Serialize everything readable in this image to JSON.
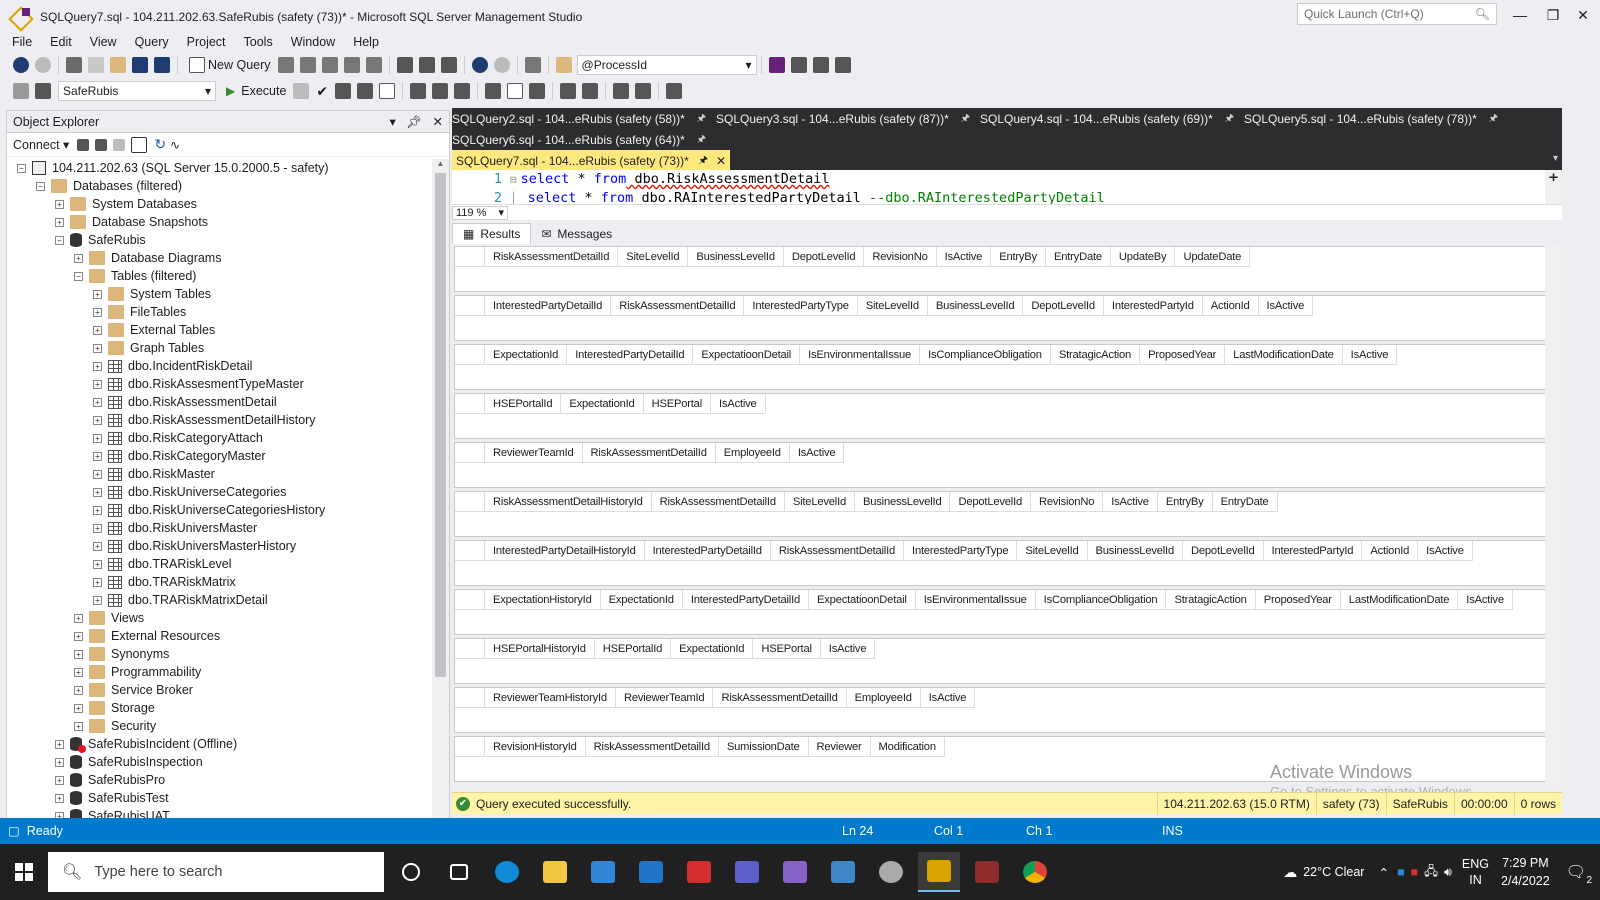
{
  "window": {
    "title": "SQLQuery7.sql - 104.211.202.63.SafeRubis (safety (73))* - Microsoft SQL Server Management Studio",
    "quick_launch_placeholder": "Quick Launch (Ctrl+Q)"
  },
  "menu": [
    "File",
    "Edit",
    "View",
    "Query",
    "Project",
    "Tools",
    "Window",
    "Help"
  ],
  "toolbar1": {
    "new_query": "New Query",
    "process_combo": "@ProcessId"
  },
  "toolbar2": {
    "db_combo": "SafeRubis",
    "execute": "Execute"
  },
  "object_explorer": {
    "title": "Object Explorer",
    "connect": "Connect",
    "tree": [
      {
        "label": "104.211.202.63 (SQL Server 15.0.2000.5 - safety)",
        "icon": "server",
        "level": 0,
        "expander": "-"
      },
      {
        "label": "Databases (filtered)",
        "icon": "folder",
        "level": 1,
        "expander": "-"
      },
      {
        "label": "System Databases",
        "icon": "folder",
        "level": 2,
        "expander": "+"
      },
      {
        "label": "Database Snapshots",
        "icon": "folder",
        "level": 2,
        "expander": "+"
      },
      {
        "label": "SafeRubis",
        "icon": "db",
        "level": 2,
        "expander": "-"
      },
      {
        "label": "Database Diagrams",
        "icon": "folder",
        "level": 3,
        "expander": "+"
      },
      {
        "label": "Tables (filtered)",
        "icon": "folder",
        "level": 3,
        "expander": "-"
      },
      {
        "label": "System Tables",
        "icon": "folder",
        "level": 4,
        "expander": "+"
      },
      {
        "label": "FileTables",
        "icon": "folder",
        "level": 4,
        "expander": "+"
      },
      {
        "label": "External Tables",
        "icon": "folder",
        "level": 4,
        "expander": "+"
      },
      {
        "label": "Graph Tables",
        "icon": "folder",
        "level": 4,
        "expander": "+"
      },
      {
        "label": "dbo.IncidentRiskDetail",
        "icon": "table",
        "level": 4,
        "expander": "+"
      },
      {
        "label": "dbo.RiskAssesmentTypeMaster",
        "icon": "table",
        "level": 4,
        "expander": "+"
      },
      {
        "label": "dbo.RiskAssessmentDetail",
        "icon": "table",
        "level": 4,
        "expander": "+"
      },
      {
        "label": "dbo.RiskAssessmentDetailHistory",
        "icon": "table",
        "level": 4,
        "expander": "+"
      },
      {
        "label": "dbo.RiskCategoryAttach",
        "icon": "table",
        "level": 4,
        "expander": "+"
      },
      {
        "label": "dbo.RiskCategoryMaster",
        "icon": "table",
        "level": 4,
        "expander": "+"
      },
      {
        "label": "dbo.RiskMaster",
        "icon": "table",
        "level": 4,
        "expander": "+"
      },
      {
        "label": "dbo.RiskUniverseCategories",
        "icon": "table",
        "level": 4,
        "expander": "+"
      },
      {
        "label": "dbo.RiskUniverseCategoriesHistory",
        "icon": "table",
        "level": 4,
        "expander": "+"
      },
      {
        "label": "dbo.RiskUniversMaster",
        "icon": "table",
        "level": 4,
        "expander": "+"
      },
      {
        "label": "dbo.RiskUniversMasterHistory",
        "icon": "table",
        "level": 4,
        "expander": "+"
      },
      {
        "label": "dbo.TRARiskLevel",
        "icon": "table",
        "level": 4,
        "expander": "+"
      },
      {
        "label": "dbo.TRARiskMatrix",
        "icon": "table",
        "level": 4,
        "expander": "+"
      },
      {
        "label": "dbo.TRARiskMatrixDetail",
        "icon": "table",
        "level": 4,
        "expander": "+"
      },
      {
        "label": "Views",
        "icon": "folder",
        "level": 3,
        "expander": "+"
      },
      {
        "label": "External Resources",
        "icon": "folder",
        "level": 3,
        "expander": "+"
      },
      {
        "label": "Synonyms",
        "icon": "folder",
        "level": 3,
        "expander": "+"
      },
      {
        "label": "Programmability",
        "icon": "folder",
        "level": 3,
        "expander": "+"
      },
      {
        "label": "Service Broker",
        "icon": "folder",
        "level": 3,
        "expander": "+"
      },
      {
        "label": "Storage",
        "icon": "folder",
        "level": 3,
        "expander": "+"
      },
      {
        "label": "Security",
        "icon": "folder",
        "level": 3,
        "expander": "+"
      },
      {
        "label": "SafeRubisIncident (Offline)",
        "icon": "dbx",
        "level": 2,
        "expander": "+"
      },
      {
        "label": "SafeRubisInspection",
        "icon": "db",
        "level": 2,
        "expander": "+"
      },
      {
        "label": "SafeRubisPro",
        "icon": "db",
        "level": 2,
        "expander": "+"
      },
      {
        "label": "SafeRubisTest",
        "icon": "db",
        "level": 2,
        "expander": "+"
      },
      {
        "label": "SafeRubisUAT",
        "icon": "db",
        "level": 2,
        "expander": "+"
      }
    ]
  },
  "doc_tabs": {
    "row1": [
      "SQLQuery2.sql - 104...eRubis (safety (58))*",
      "SQLQuery3.sql - 104...eRubis (safety (87))*",
      "SQLQuery4.sql - 104...eRubis (safety (69))*",
      "SQLQuery5.sql - 104...eRubis (safety (78))*"
    ],
    "row2": [
      "SQLQuery6.sql - 104...eRubis (safety (64))*"
    ],
    "active": "SQLQuery7.sql - 104...eRubis (safety (73))*"
  },
  "editor": {
    "line1": {
      "num": "1",
      "kw1": "select",
      "star": " * ",
      "kw2": "from",
      "obj": " dbo.RiskAssessmentDetail"
    },
    "line2": {
      "num": "2",
      "kw1": "select",
      "star": " * ",
      "kw2": "from",
      "obj": " dbo.RAInterestedPartyDetail",
      "cmt": "  --dbo.RAInterestedPartyDetail"
    },
    "zoom": "119 %"
  },
  "result_tabs": {
    "results": "Results",
    "messages": "Messages"
  },
  "grids": [
    [
      "RiskAssessmentDetailId",
      "SiteLevelId",
      "BusinessLevelId",
      "DepotLevelId",
      "RevisionNo",
      "IsActive",
      "EntryBy",
      "EntryDate",
      "UpdateBy",
      "UpdateDate"
    ],
    [
      "InterestedPartyDetailId",
      "RiskAssessmentDetailId",
      "InterestedPartyType",
      "SiteLevelId",
      "BusinessLevelId",
      "DepotLevelId",
      "InterestedPartyId",
      "ActionId",
      "IsActive"
    ],
    [
      "ExpectationId",
      "InterestedPartyDetailId",
      "ExpectatioonDetail",
      "IsEnvironmentalIssue",
      "IsComplianceObligation",
      "StratagicAction",
      "ProposedYear",
      "LastModificationDate",
      "IsActive"
    ],
    [
      "HSEPortalId",
      "ExpectationId",
      "HSEPortal",
      "IsActive"
    ],
    [
      "ReviewerTeamId",
      "RiskAssessmentDetailId",
      "EmployeeId",
      "IsActive"
    ],
    [
      "RiskAssessmentDetailHistoryId",
      "RiskAssessmentDetailId",
      "SiteLevelId",
      "BusinessLevelId",
      "DepotLevelId",
      "RevisionNo",
      "IsActive",
      "EntryBy",
      "EntryDate"
    ],
    [
      "InterestedPartyDetailHistoryId",
      "InterestedPartyDetailId",
      "RiskAssessmentDetailId",
      "InterestedPartyType",
      "SiteLevelId",
      "BusinessLevelId",
      "DepotLevelId",
      "InterestedPartyId",
      "ActionId",
      "IsActive"
    ],
    [
      "ExpectationHistoryId",
      "ExpectationId",
      "InterestedPartyDetailId",
      "ExpectatioonDetail",
      "IsEnvironmentalIssue",
      "IsComplianceObligation",
      "StratagicAction",
      "ProposedYear",
      "LastModificationDate",
      "IsActive"
    ],
    [
      "HSEPortalHistoryId",
      "HSEPortalId",
      "ExpectationId",
      "HSEPortal",
      "IsActive"
    ],
    [
      "ReviewerTeamHistoryId",
      "ReviewerTeamId",
      "RiskAssessmentDetailId",
      "EmployeeId",
      "IsActive"
    ],
    [
      "RevisionHistoryId",
      "RiskAssessmentDetailId",
      "SumissionDate",
      "Reviewer",
      "Modification"
    ]
  ],
  "query_status": {
    "message": "Query executed successfully.",
    "server": "104.211.202.63 (15.0 RTM)",
    "user": "safety (73)",
    "db": "SafeRubis",
    "time": "00:00:00",
    "rows": "0 rows"
  },
  "watermark": {
    "line1": "Activate Windows",
    "line2": "Go to Settings to activate Windows."
  },
  "status_bar": {
    "ready": "Ready",
    "ln": "Ln 24",
    "col": "Col 1",
    "ch": "Ch 1",
    "ins": "INS"
  },
  "taskbar": {
    "search_placeholder": "Type here to search",
    "weather": "22°C  Clear",
    "lang1": "ENG",
    "lang2": "IN",
    "time": "7:29 PM",
    "date": "2/4/2022",
    "notifications": "2"
  },
  "colors": {
    "accent": "#007acc",
    "tab_active": "#ffe97f",
    "status_yellow": "#fff4a8",
    "dark_tabs": "#2d2d30"
  }
}
